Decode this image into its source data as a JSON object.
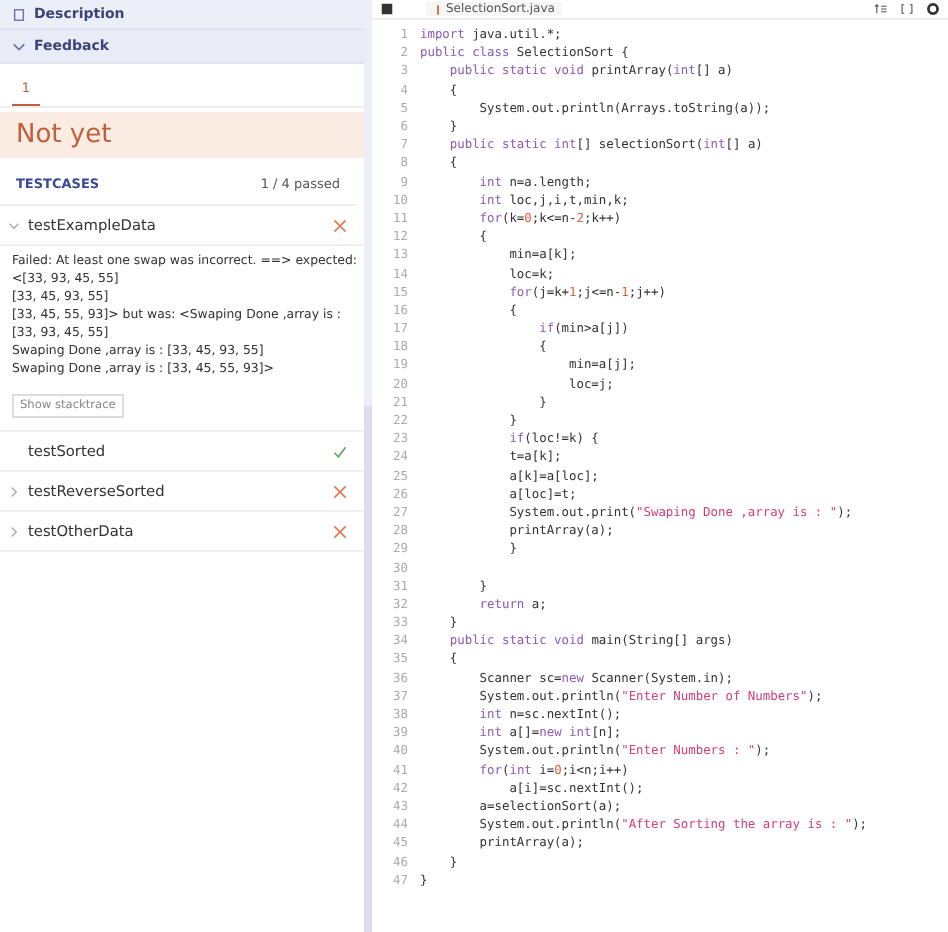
{
  "feedback_panel": {
    "sections": [
      {
        "label": "Description",
        "expanded": false
      },
      {
        "label": "Feedback",
        "expanded": true
      }
    ],
    "attempts": [
      {
        "label": "1",
        "selected": true
      }
    ],
    "result": "Not yet",
    "testcases": {
      "title": "TESTCASES",
      "summary": "1 / 4 passed",
      "items": [
        {
          "name": "testExampleData",
          "passed": false,
          "expanded": true,
          "message": [
            "Failed: At least one swap was incorrect. ==> expected:",
            "<[33, 93, 45, 55]",
            "[33, 45, 93, 55]",
            "[33, 45, 55, 93]> but was: <Swaping Done ,array is :",
            "[33, 93, 45, 55]",
            "Swaping Done ,array is : [33, 45, 93, 55]",
            "Swaping Done ,array is : [33, 45, 55, 93]>"
          ],
          "button": "Show stacktrace"
        },
        {
          "name": "testSorted",
          "passed": true
        },
        {
          "name": "testReverseSorted",
          "passed": false,
          "expanded": false
        },
        {
          "name": "testOtherData",
          "passed": false,
          "expanded": false
        }
      ]
    }
  },
  "editor": {
    "file_tab": "SelectionSort.java",
    "lines": [
      {
        "number": "1",
        "segments": [
          {
            "text": "import",
            "kind": "keyword"
          },
          {
            "text": " java.util.*;",
            "kind": "plain"
          }
        ]
      },
      {
        "number": "2",
        "segments": [
          {
            "text": "public class",
            "kind": "keyword"
          },
          {
            "text": " SelectionSort {",
            "kind": "plain"
          }
        ]
      },
      {
        "number": "3",
        "segments": [
          {
            "text": "    public static void",
            "kind": "keyword"
          },
          {
            "text": " printArray(",
            "kind": "plain"
          },
          {
            "text": "int",
            "kind": "keyword"
          },
          {
            "text": "[] a)",
            "kind": "plain"
          }
        ]
      },
      {
        "number": "4",
        "segments": [
          {
            "text": "    {",
            "kind": "plain"
          }
        ]
      },
      {
        "number": "5",
        "segments": [
          {
            "text": "        System.out.println(Arrays.toString(a));",
            "kind": "plain"
          }
        ]
      },
      {
        "number": "6",
        "segments": [
          {
            "text": "    }",
            "kind": "plain"
          }
        ]
      },
      {
        "number": "7",
        "segments": [
          {
            "text": "    public static int",
            "kind": "keyword"
          },
          {
            "text": "[] selectionSort(",
            "kind": "plain"
          },
          {
            "text": "int",
            "kind": "keyword"
          },
          {
            "text": "[] a)",
            "kind": "plain"
          }
        ]
      },
      {
        "number": "8",
        "segments": [
          {
            "text": "    {",
            "kind": "plain"
          }
        ]
      },
      {
        "number": "9",
        "segments": [
          {
            "text": "        int",
            "kind": "keyword"
          },
          {
            "text": " n=a.length;",
            "kind": "plain"
          }
        ]
      },
      {
        "number": "10",
        "segments": [
          {
            "text": "        int",
            "kind": "keyword"
          },
          {
            "text": " loc,j,i,t,min,k;",
            "kind": "plain"
          }
        ]
      },
      {
        "number": "11",
        "segments": [
          {
            "text": "        for",
            "kind": "keyword"
          },
          {
            "text": "(k=",
            "kind": "plain"
          },
          {
            "text": "0",
            "kind": "number"
          },
          {
            "text": ";k<=n-",
            "kind": "plain"
          },
          {
            "text": "2",
            "kind": "number"
          },
          {
            "text": ";k++)",
            "kind": "plain"
          }
        ]
      },
      {
        "number": "12",
        "segments": [
          {
            "text": "        {",
            "kind": "plain"
          }
        ]
      },
      {
        "number": "13",
        "segments": [
          {
            "text": "            min=a[k];",
            "kind": "plain"
          }
        ]
      },
      {
        "number": "14",
        "segments": [
          {
            "text": "            loc=k;",
            "kind": "plain"
          }
        ]
      },
      {
        "number": "15",
        "segments": [
          {
            "text": "            for",
            "kind": "keyword"
          },
          {
            "text": "(j=k+",
            "kind": "plain"
          },
          {
            "text": "1",
            "kind": "number"
          },
          {
            "text": ";j<=n-",
            "kind": "plain"
          },
          {
            "text": "1",
            "kind": "number"
          },
          {
            "text": ";j++)",
            "kind": "plain"
          }
        ]
      },
      {
        "number": "16",
        "segments": [
          {
            "text": "            {",
            "kind": "plain"
          }
        ]
      },
      {
        "number": "17",
        "segments": [
          {
            "text": "                if",
            "kind": "keyword"
          },
          {
            "text": "(min>a[j])",
            "kind": "plain"
          }
        ]
      },
      {
        "number": "18",
        "segments": [
          {
            "text": "                {",
            "kind": "plain"
          }
        ]
      },
      {
        "number": "19",
        "segments": [
          {
            "text": "                    min=a[j];",
            "kind": "plain"
          }
        ]
      },
      {
        "number": "20",
        "segments": [
          {
            "text": "                    loc=j;",
            "kind": "plain"
          }
        ]
      },
      {
        "number": "21",
        "segments": [
          {
            "text": "                }",
            "kind": "plain"
          }
        ]
      },
      {
        "number": "22",
        "segments": [
          {
            "text": "            }",
            "kind": "plain"
          }
        ]
      },
      {
        "number": "23",
        "segments": [
          {
            "text": "            if",
            "kind": "keyword"
          },
          {
            "text": "(loc!=k) {",
            "kind": "plain"
          }
        ]
      },
      {
        "number": "24",
        "segments": [
          {
            "text": "            t=a[k];",
            "kind": "plain"
          }
        ]
      },
      {
        "number": "25",
        "segments": [
          {
            "text": "            a[k]=a[loc];",
            "kind": "plain"
          }
        ]
      },
      {
        "number": "26",
        "segments": [
          {
            "text": "            a[loc]=t;",
            "kind": "plain"
          }
        ]
      },
      {
        "number": "27",
        "segments": [
          {
            "text": "            System.out.print(",
            "kind": "plain"
          },
          {
            "text": "\"Swaping Done ,array is : \"",
            "kind": "string"
          },
          {
            "text": ");",
            "kind": "plain"
          }
        ]
      },
      {
        "number": "28",
        "segments": [
          {
            "text": "            printArray(a);",
            "kind": "plain"
          }
        ]
      },
      {
        "number": "29",
        "segments": [
          {
            "text": "            }",
            "kind": "plain"
          }
        ]
      },
      {
        "number": "30"
      },
      {
        "number": "31",
        "segments": [
          {
            "text": "        }",
            "kind": "plain"
          }
        ]
      },
      {
        "number": "32",
        "segments": [
          {
            "text": "        return",
            "kind": "keyword"
          },
          {
            "text": " a;",
            "kind": "plain"
          }
        ]
      },
      {
        "number": "33",
        "segments": [
          {
            "text": "    }",
            "kind": "plain"
          }
        ]
      },
      {
        "number": "34",
        "segments": [
          {
            "text": "    public static void",
            "kind": "keyword"
          },
          {
            "text": " main(String[] args)",
            "kind": "plain"
          }
        ]
      },
      {
        "number": "35",
        "segments": [
          {
            "text": "    {",
            "kind": "plain"
          }
        ]
      },
      {
        "number": "36",
        "segments": [
          {
            "text": "        Scanner sc=",
            "kind": "plain"
          },
          {
            "text": "new",
            "kind": "keyword"
          },
          {
            "text": " Scanner(System.in);",
            "kind": "plain"
          }
        ]
      },
      {
        "number": "37",
        "segments": [
          {
            "text": "        System.out.println(",
            "kind": "plain"
          },
          {
            "text": "\"Enter Number of Numbers\"",
            "kind": "string"
          },
          {
            "text": ");",
            "kind": "plain"
          }
        ]
      },
      {
        "number": "38",
        "segments": [
          {
            "text": "        int",
            "kind": "keyword"
          },
          {
            "text": " n=sc.nextInt();",
            "kind": "plain"
          }
        ]
      },
      {
        "number": "39",
        "segments": [
          {
            "text": "        int",
            "kind": "keyword"
          },
          {
            "text": " a[]=",
            "kind": "plain"
          },
          {
            "text": "new int",
            "kind": "keyword"
          },
          {
            "text": "[n];",
            "kind": "plain"
          }
        ]
      },
      {
        "number": "40",
        "segments": [
          {
            "text": "        System.out.println(",
            "kind": "plain"
          },
          {
            "text": "\"Enter Numbers : \"",
            "kind": "string"
          },
          {
            "text": ");",
            "kind": "plain"
          }
        ]
      },
      {
        "number": "41",
        "segments": [
          {
            "text": "        for",
            "kind": "keyword"
          },
          {
            "text": "(",
            "kind": "plain"
          },
          {
            "text": "int",
            "kind": "keyword"
          },
          {
            "text": " i=",
            "kind": "plain"
          },
          {
            "text": "0",
            "kind": "number"
          },
          {
            "text": ";i<n;i++)",
            "kind": "plain"
          }
        ]
      },
      {
        "number": "42",
        "segments": [
          {
            "text": "            a[i]=sc.nextInt();",
            "kind": "plain"
          }
        ]
      },
      {
        "number": "43",
        "segments": [
          {
            "text": "        a=selectionSort(a);",
            "kind": "plain"
          }
        ]
      },
      {
        "number": "44",
        "segments": [
          {
            "text": "        System.out.println(",
            "kind": "plain"
          },
          {
            "text": "\"After Sorting the array is : \"",
            "kind": "string"
          },
          {
            "text": ");",
            "kind": "plain"
          }
        ]
      },
      {
        "number": "45",
        "segments": [
          {
            "text": "        printArray(a);",
            "kind": "plain"
          }
        ]
      },
      {
        "number": "46",
        "segments": [
          {
            "text": "    }",
            "kind": "plain"
          }
        ]
      },
      {
        "number": "47",
        "segments": [
          {
            "text": "}",
            "kind": "plain"
          }
        ]
      }
    ]
  }
}
